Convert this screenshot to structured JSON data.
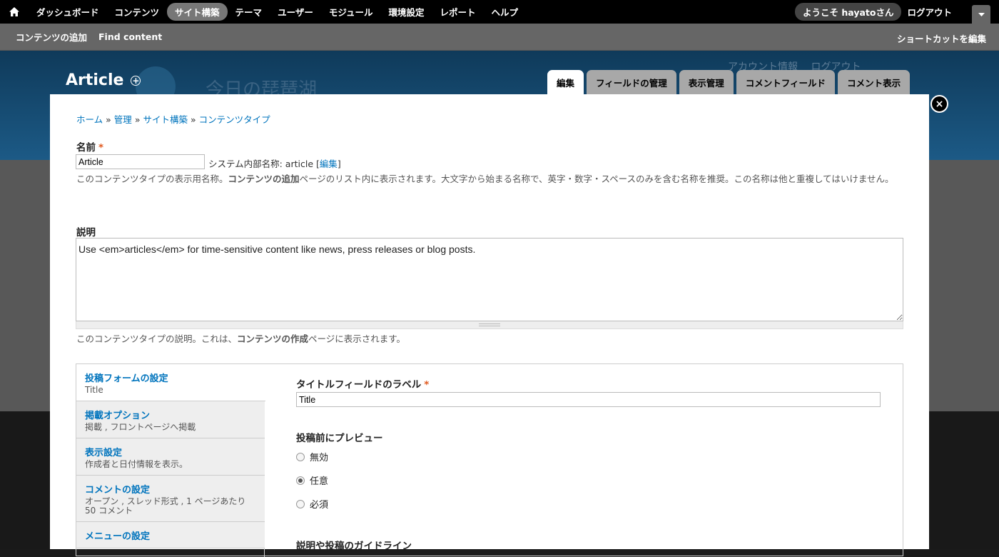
{
  "toolbar": {
    "menu": [
      "ダッシュボード",
      "コンテンツ",
      "サイト構築",
      "テーマ",
      "ユーザー",
      "モジュール",
      "環境設定",
      "レポート",
      "ヘルプ"
    ],
    "welcome": "ようこそ hayatoさん",
    "logout": "ログアウト"
  },
  "shortcuts": {
    "items": [
      "コンテンツの追加",
      "Find content"
    ],
    "edit": "ショートカットを編集"
  },
  "header": {
    "site_name": "今日の琵琶湖",
    "account": "アカウント情報",
    "logout": "ログアウト"
  },
  "overlay": {
    "title": "Article",
    "tabs": [
      "編集",
      "フィールドの管理",
      "表示管理",
      "コメントフィールド",
      "コメント表示"
    ],
    "close": "×"
  },
  "breadcrumb": [
    "ホーム",
    "管理",
    "サイト構築",
    "コンテンツタイプ"
  ],
  "form": {
    "name_label": "名前",
    "required": "*",
    "name_value": "Article",
    "machine_name_prefix": "システム内部名称: article [",
    "machine_name_edit": "編集",
    "machine_name_suffix": "]",
    "name_desc_1": "このコンテンツタイプの表示用名称。",
    "name_desc_bold": "コンテンツの追加",
    "name_desc_2": "ページのリスト内に表示されます。大文字から始まる名称で、英字・数字・スペースのみを含む名称を推奨。この名称は他と重複してはいけません。",
    "description_label": "説明",
    "description_value": "Use <em>articles</em> for time-sensitive content like news, press releases or blog posts.",
    "desc_help_1": "このコンテンツタイプの説明。これは、",
    "desc_help_bold": "コンテンツの作成",
    "desc_help_2": "ページに表示されます。"
  },
  "vtabs": [
    {
      "title": "投稿フォームの設定",
      "summary": "Title"
    },
    {
      "title": "掲載オプション",
      "summary": "掲載 , フロントページへ掲載"
    },
    {
      "title": "表示設定",
      "summary": "作成者と日付情報を表示。"
    },
    {
      "title": "コメントの設定",
      "summary": "オープン , スレッド形式 , 1 ページあたり 50 コメント"
    },
    {
      "title": "メニューの設定",
      "summary": ""
    }
  ],
  "pane": {
    "title_label": "タイトルフィールドのラベル",
    "title_value": "Title",
    "preview_label": "投稿前にプレビュー",
    "preview_options": [
      "無効",
      "任意",
      "必須"
    ],
    "preview_selected": "任意",
    "guide_label": "説明や投稿のガイドライン"
  }
}
